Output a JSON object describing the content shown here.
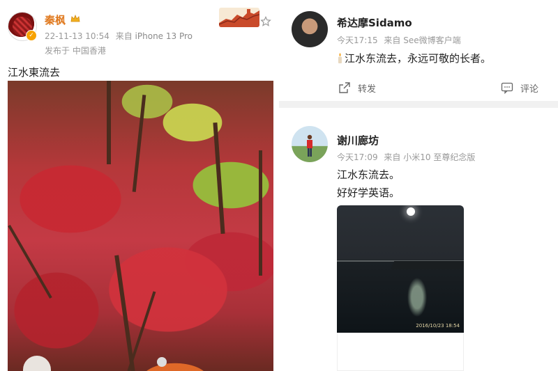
{
  "left_post": {
    "username": "秦枫",
    "timestamp": "22-11-13 10:54",
    "source_prefix": "来自",
    "device": "iPhone 13 Pro",
    "location": "发布于 中国香港",
    "text": "江水東流去",
    "icons": [
      "avatar",
      "verified-badge-icon",
      "crown-icon",
      "great-wall-banner",
      "star-icon"
    ],
    "colors": {
      "username": "#e07a20",
      "badge": "#f7a200"
    }
  },
  "right_posts": [
    {
      "username": "希达摩Sidamo",
      "time": "今天17:15",
      "source": "来自 See微博客户端",
      "text": "江水东流去，永远可敬的长者。",
      "actions": {
        "repost": "转发",
        "comment": "评论"
      }
    },
    {
      "username": "谢川廊坊",
      "time": "今天17:09",
      "source": "来自 小米10 至尊纪念版",
      "lines": [
        "江水东流去。",
        "好好学英语。"
      ],
      "photo_stamp": "2016/10/23  18:54"
    }
  ]
}
